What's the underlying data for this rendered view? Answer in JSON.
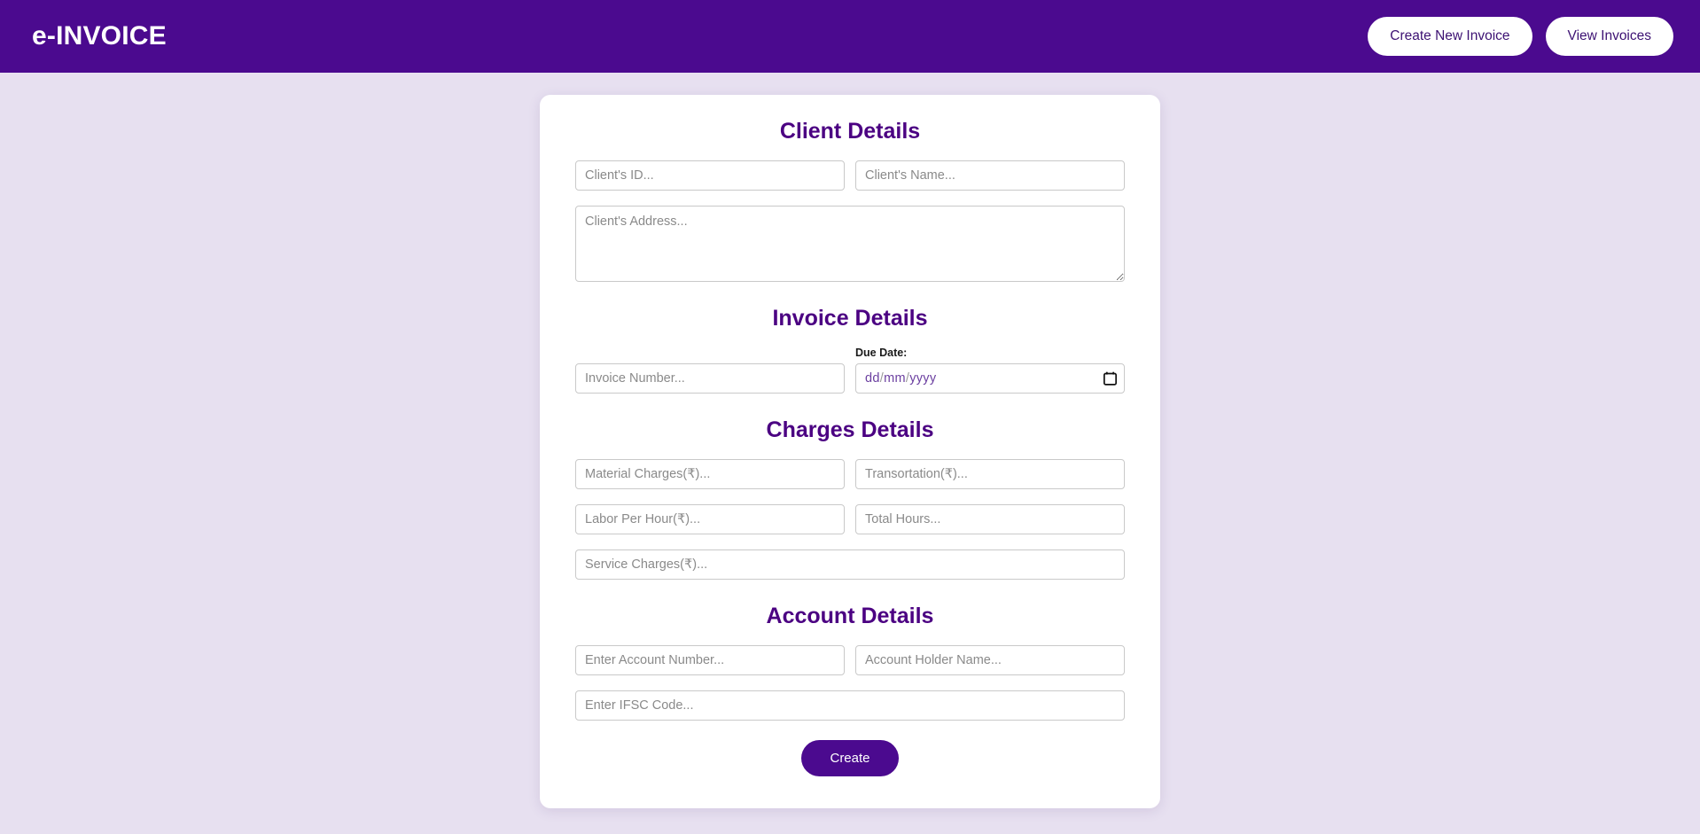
{
  "header": {
    "brand": "e-INVOICE",
    "buttons": [
      {
        "label": "Create New Invoice",
        "name": "create-new-invoice-button"
      },
      {
        "label": "View Invoices",
        "name": "view-invoices-button"
      }
    ]
  },
  "form": {
    "client_section": {
      "title": "Client Details",
      "client_id_placeholder": "Client's ID...",
      "client_id_value": "",
      "client_name_placeholder": "Client's Name...",
      "client_name_value": "",
      "client_address_placeholder": "Client's Address...",
      "client_address_value": ""
    },
    "invoice_section": {
      "title": "Invoice Details",
      "invoice_number_placeholder": "Invoice Number...",
      "invoice_number_value": "",
      "due_date_label": "Due Date:",
      "due_date_day": "dd",
      "due_date_month": "mm",
      "due_date_year": "yyyy",
      "due_date_separator": "/",
      "calendar_icon": "calendar-icon"
    },
    "charges_section": {
      "title": "Charges Details",
      "material_charges_placeholder": "Material Charges(₹)...",
      "material_charges_value": "",
      "transportation_placeholder": "Transortation(₹)...",
      "transportation_value": "",
      "labor_per_hour_placeholder": "Labor Per Hour(₹)...",
      "labor_per_hour_value": "",
      "total_hours_placeholder": "Total Hours...",
      "total_hours_value": "",
      "service_charges_placeholder": "Service Charges(₹)...",
      "service_charges_value": ""
    },
    "account_section": {
      "title": "Account Details",
      "account_number_placeholder": "Enter Account Number...",
      "account_number_value": "",
      "account_holder_placeholder": "Account Holder Name...",
      "account_holder_value": "",
      "ifsc_placeholder": "Enter IFSC Code...",
      "ifsc_value": ""
    },
    "submit_label": "Create"
  },
  "colors": {
    "header_purple": "#4b0a8f",
    "heading_purple": "#4b0082",
    "page_background": "#e7e0f0",
    "card_background": "#ffffff",
    "button_text_purple": "#3d1273",
    "input_border": "#c9c9c9",
    "placeholder_gray": "#8a8a8a"
  }
}
